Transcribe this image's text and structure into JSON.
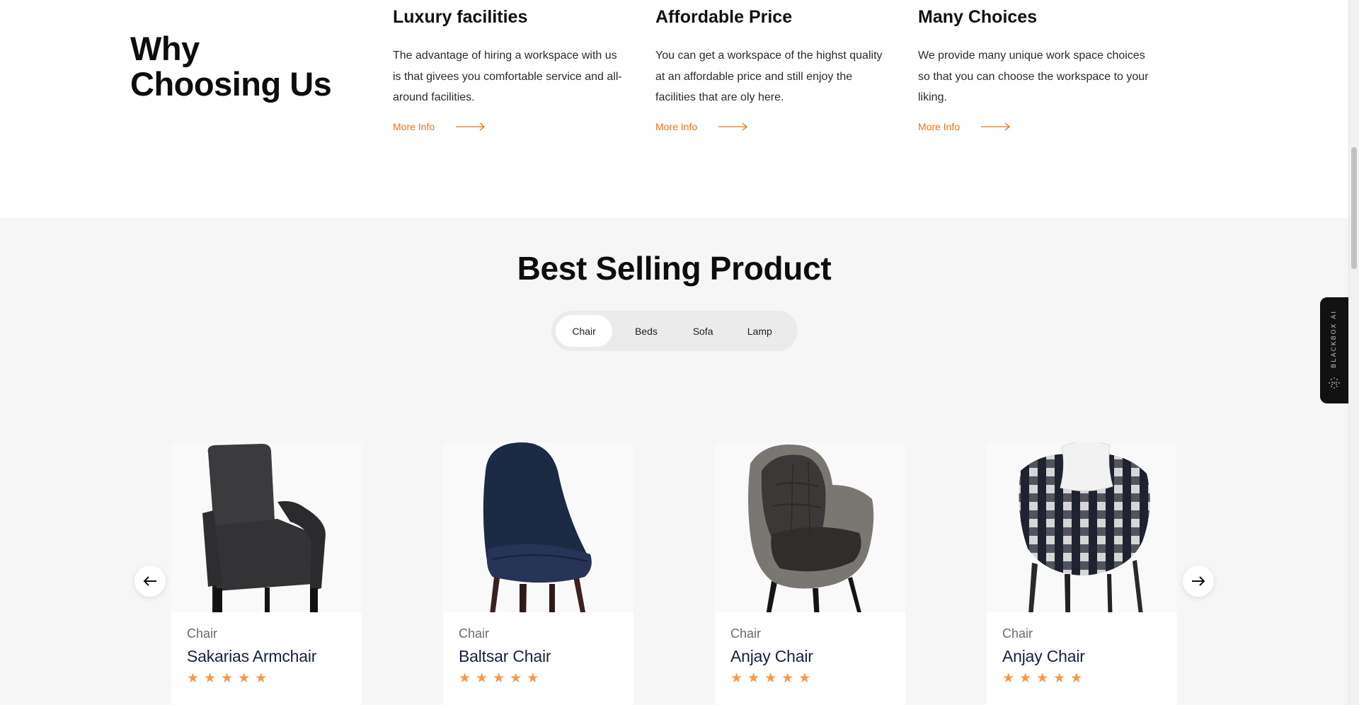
{
  "why": {
    "title": "Why Choosing Us",
    "features": [
      {
        "title": "Luxury facilities",
        "text": "The advantage of hiring a workspace with us is that givees you comfortable service and all-around facilities.",
        "link": "More Info"
      },
      {
        "title": "Affordable Price",
        "text": "You can get a workspace of the highst quality at an affordable price and still enjoy the facilities that are oly here.",
        "link": "More Info"
      },
      {
        "title": "Many Choices",
        "text": "We provide many unique work space choices so that you can choose the workspace to your liking.",
        "link": "More Info"
      }
    ]
  },
  "best": {
    "title": "Best Selling Product",
    "tabs": [
      "Chair",
      "Beds",
      "Sofa",
      "Lamp"
    ],
    "active_tab": "Chair",
    "products": [
      {
        "category": "Chair",
        "name": "Sakarias Armchair",
        "rating": 5
      },
      {
        "category": "Chair",
        "name": "Baltsar Chair",
        "rating": 5
      },
      {
        "category": "Chair",
        "name": "Anjay Chair",
        "rating": 5
      },
      {
        "category": "Chair",
        "name": "Anjay Chair",
        "rating": 5
      }
    ]
  },
  "widget": {
    "label": "BLACKBOX AI"
  },
  "colors": {
    "accent": "#e9731b",
    "star": "#f29a4a",
    "section_bg": "#f6f6f6",
    "heading": "#0d0d0d",
    "product_name": "#16213e"
  },
  "icons": {
    "prev": "arrow-left-icon",
    "next": "arrow-right-icon",
    "more": "long-arrow-right-icon",
    "star": "star-icon"
  }
}
